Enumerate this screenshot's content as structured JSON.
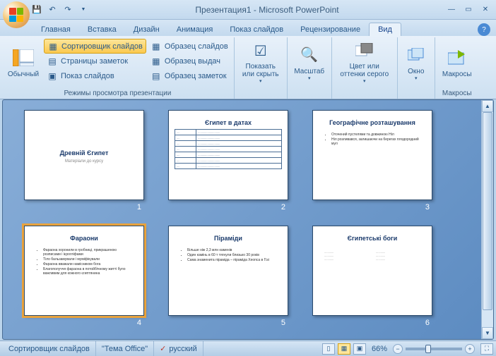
{
  "window": {
    "title": "Презентация1 - Microsoft PowerPoint"
  },
  "tabs": {
    "home": "Главная",
    "insert": "Вставка",
    "design": "Дизайн",
    "animation": "Анимация",
    "slideshow": "Показ слайдов",
    "review": "Рецензирование",
    "view": "Вид"
  },
  "ribbon": {
    "group_views": "Режимы просмотра презентации",
    "normal": "Обычный",
    "sorter": "Сортировщик слайдов",
    "notes": "Страницы заметок",
    "show": "Показ слайдов",
    "master_slide": "Образец слайдов",
    "master_handout": "Образец выдач",
    "master_notes": "Образец заметок",
    "show_hide": "Показать или скрыть",
    "zoom": "Масштаб",
    "color": "Цвет или оттенки серого",
    "window": "Окно",
    "macros": "Макросы",
    "group_macros": "Макросы"
  },
  "slides": [
    {
      "num": "1",
      "title": "Древній Єгипет",
      "sub": "Матеріали до курсу",
      "type": "title"
    },
    {
      "num": "2",
      "title": "Єгипет в датах",
      "type": "table"
    },
    {
      "num": "3",
      "title": "Географічне розташування",
      "type": "bullets",
      "bullets": [
        "Оточений пустелями та довжиною Ніл",
        "Ніл розливався, залишаючи на берегах плодородний мул"
      ]
    },
    {
      "num": "4",
      "title": "Фараони",
      "type": "bullets",
      "selected": true,
      "bullets": [
        "Фараона хоронили в гробниці, прикрашеною розписами і ієрогліфами",
        "Тіло бальзамували і муміфікували",
        "Фараона вважали намісником бога",
        "Благополуччя фараона в потойбічному житті було важливим для кожного єгиптянина"
      ]
    },
    {
      "num": "5",
      "title": "Піраміди",
      "type": "bullets",
      "bullets": [
        "Більше ніж 2,3 млн каменів",
        "Один камінь в 60 т тягнули близько 30 років",
        "Сама знаменита піраміда – піраміда Хеопса в Гізі"
      ]
    },
    {
      "num": "6",
      "title": "Єгипетські боги",
      "type": "cols"
    }
  ],
  "status": {
    "mode": "Сортировщик слайдов",
    "theme": "\"Тема Office\"",
    "lang": "русский",
    "zoom": "66%"
  }
}
